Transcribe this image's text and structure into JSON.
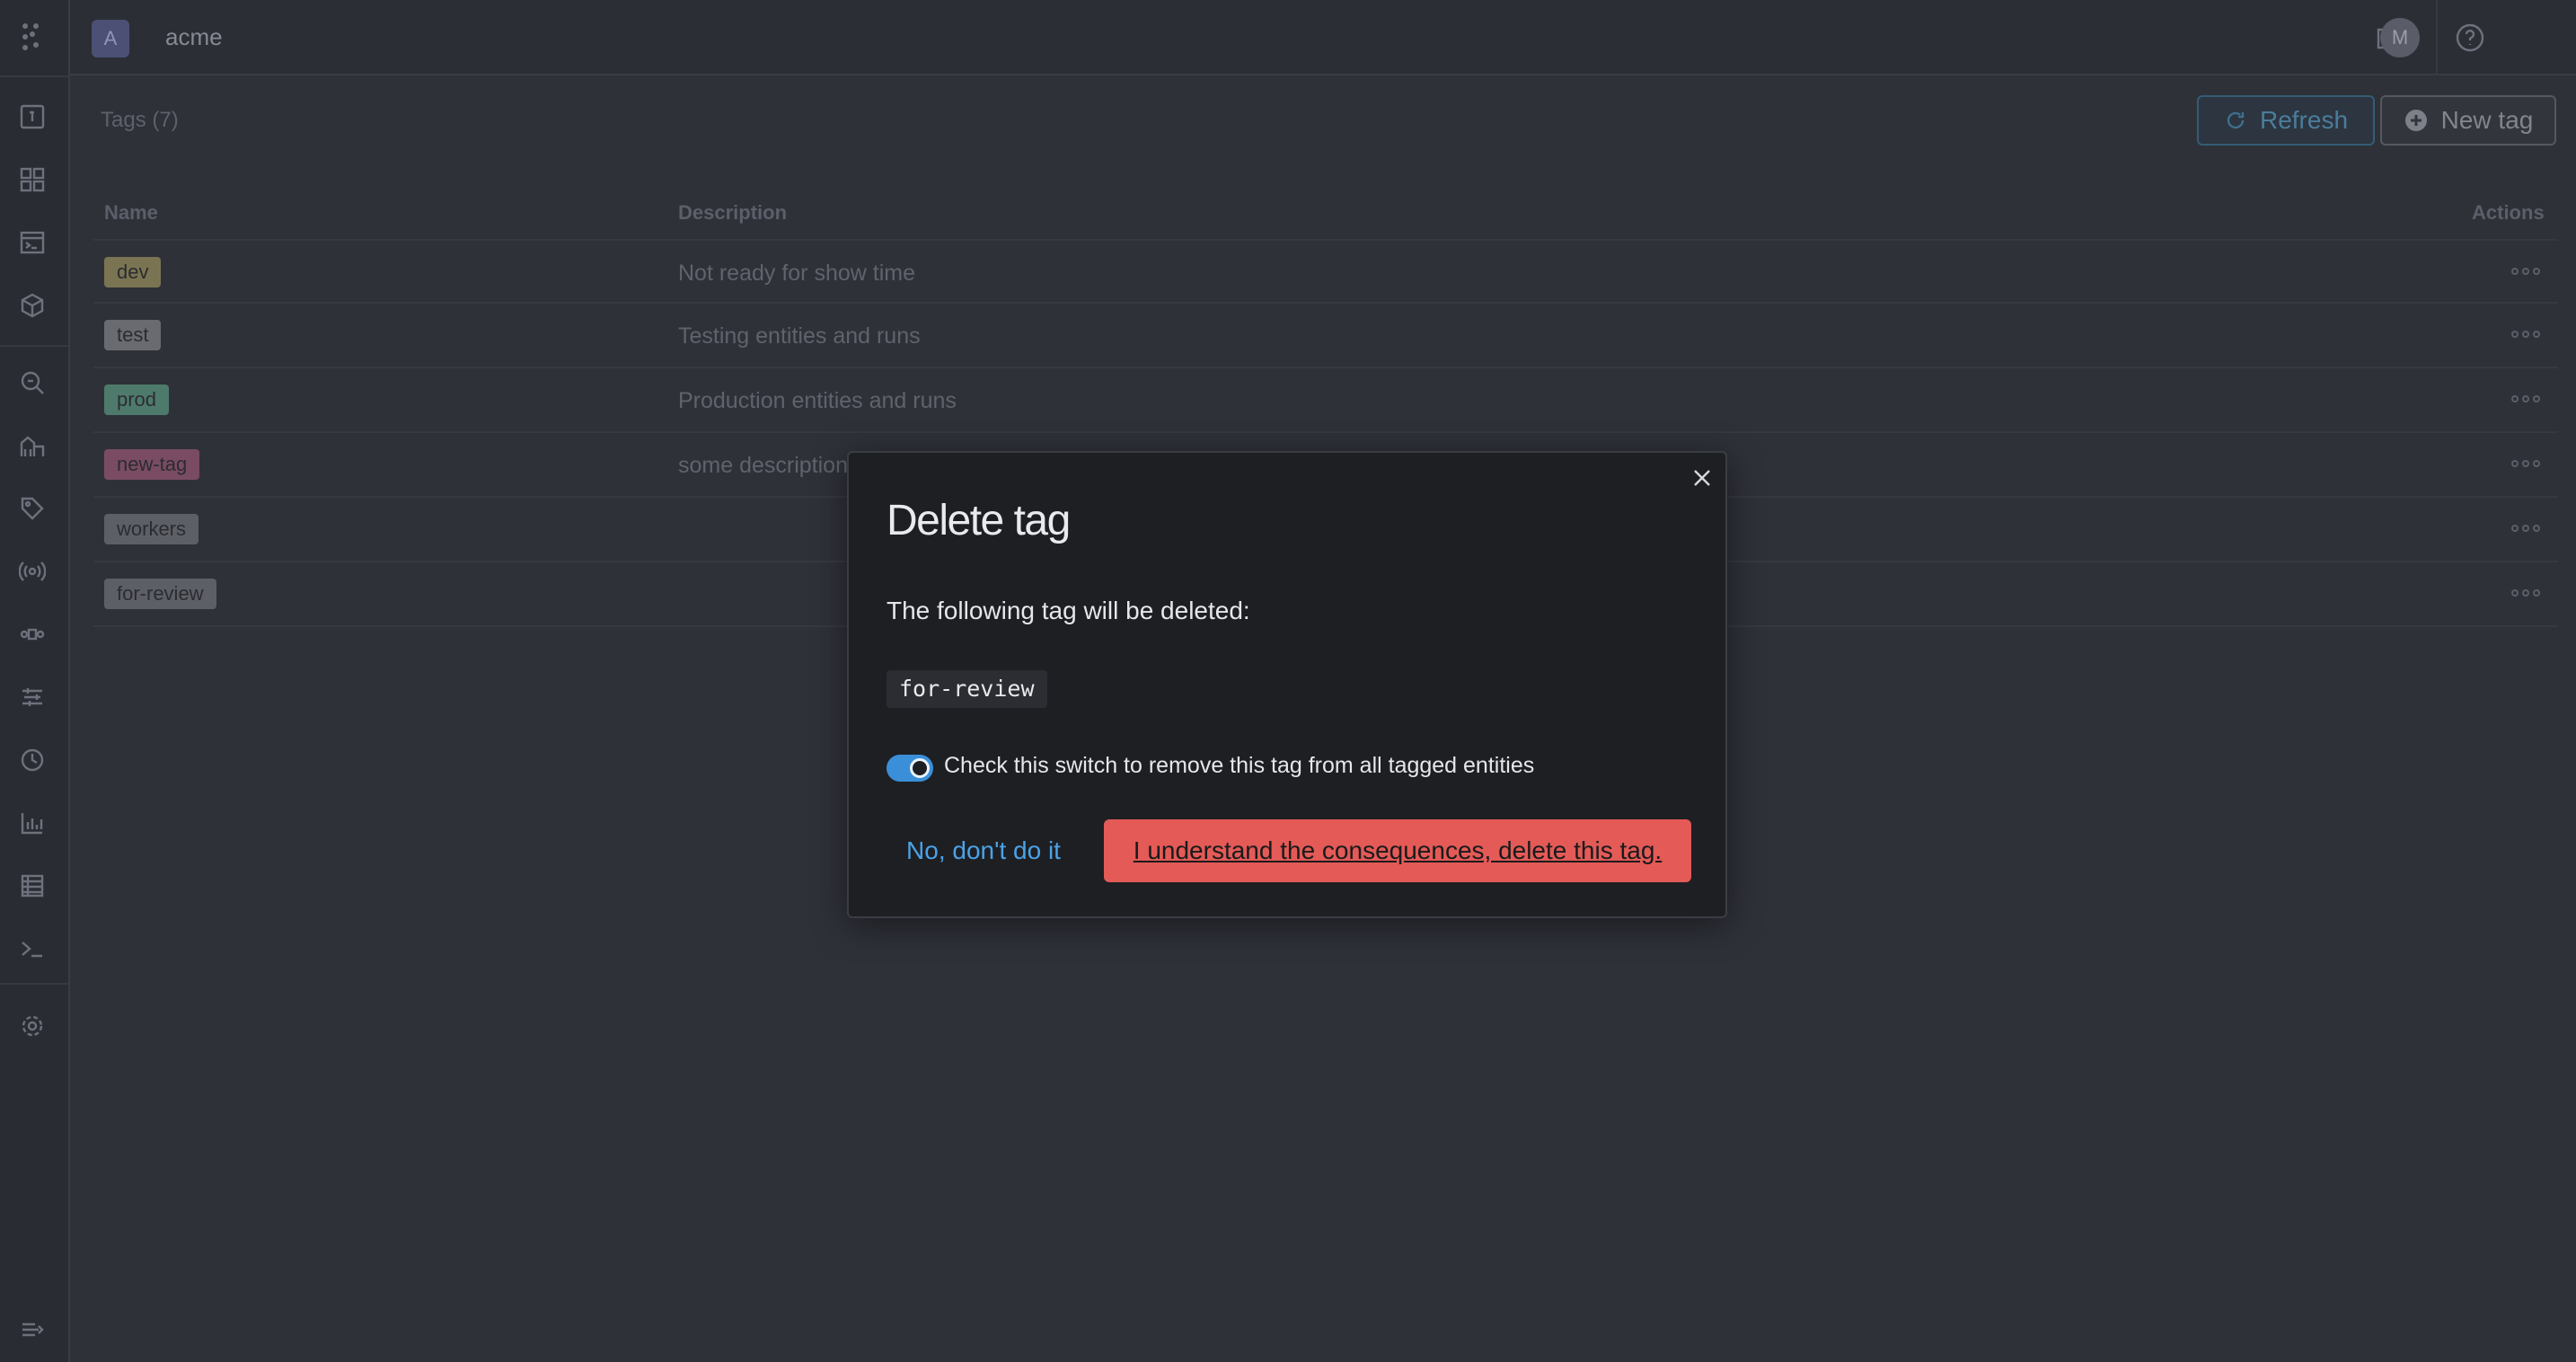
{
  "org": {
    "badge": "A",
    "name": "acme"
  },
  "user": {
    "avatar_initial": "M"
  },
  "page": {
    "title": "Tags (7)",
    "refresh_label": "Refresh",
    "new_tag_label": "New tag"
  },
  "table": {
    "headers": {
      "name": "Name",
      "description": "Description",
      "actions": "Actions"
    },
    "rows": [
      {
        "name": "dev",
        "description": "Not ready for show time",
        "color": "#7a7452"
      },
      {
        "name": "test",
        "description": "Testing entities and runs",
        "color": "#6a6b70"
      },
      {
        "name": "prod",
        "description": "Production entities and runs",
        "color": "#4e7a6c"
      },
      {
        "name": "new-tag",
        "description": "some description",
        "color": "#7a4c63"
      },
      {
        "name": "workers",
        "description": "",
        "color": "#5d5f66"
      },
      {
        "name": "for-review",
        "description": "",
        "color": "#5d5f66"
      }
    ]
  },
  "modal": {
    "title": "Delete tag",
    "text": "The following tag will be deleted:",
    "tag_name": "for-review",
    "switch_label": "Check this switch to remove this tag from all tagged entities",
    "switch_on": true,
    "cancel_label": "No, don't do it",
    "confirm_label": "I understand the consequences, delete this tag."
  },
  "colors": {
    "accent": "#3b8fd8",
    "danger": "#e35a56"
  }
}
